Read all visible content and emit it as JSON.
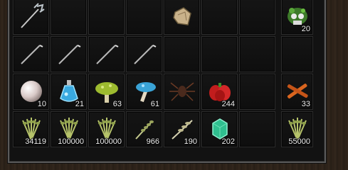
{
  "inventory": {
    "rows": [
      [
        {
          "icon": "trident-icon",
          "qty": ""
        },
        {
          "icon": "",
          "qty": ""
        },
        {
          "icon": "",
          "qty": ""
        },
        {
          "icon": "",
          "qty": ""
        },
        {
          "icon": "rock-chunk-icon",
          "qty": ""
        },
        {
          "icon": "",
          "qty": ""
        },
        {
          "icon": "",
          "qty": ""
        },
        {
          "icon": "skull-moss-icon",
          "qty": "20"
        }
      ],
      [
        {
          "icon": "fishing-hook-icon",
          "qty": ""
        },
        {
          "icon": "fishing-hook-icon",
          "qty": ""
        },
        {
          "icon": "fishing-hook-icon",
          "qty": ""
        },
        {
          "icon": "fishing-hook-icon",
          "qty": ""
        },
        {
          "icon": "",
          "qty": ""
        },
        {
          "icon": "",
          "qty": ""
        },
        {
          "icon": "",
          "qty": ""
        },
        {
          "icon": "",
          "qty": ""
        }
      ],
      [
        {
          "icon": "pearl-icon",
          "qty": "10"
        },
        {
          "icon": "blue-potion-icon",
          "qty": "21"
        },
        {
          "icon": "green-mushroom-icon",
          "qty": "63"
        },
        {
          "icon": "blue-mushroom-icon",
          "qty": "61"
        },
        {
          "icon": "spider-icon",
          "qty": ""
        },
        {
          "icon": "red-peppers-icon",
          "qty": "244"
        },
        {
          "icon": "",
          "qty": ""
        },
        {
          "icon": "cinnamon-sticks-icon",
          "qty": "33"
        }
      ],
      [
        {
          "icon": "herb-bundle-icon",
          "qty": "34119"
        },
        {
          "icon": "herb-bundle-icon",
          "qty": "100000"
        },
        {
          "icon": "herb-bundle-icon",
          "qty": "100000"
        },
        {
          "icon": "wheat-sprig-icon",
          "qty": "966"
        },
        {
          "icon": "wheat-stalk-icon",
          "qty": "190"
        },
        {
          "icon": "emerald-gem-icon",
          "qty": "202"
        },
        {
          "icon": "",
          "qty": ""
        },
        {
          "icon": "herb-bundle-icon",
          "qty": "55000"
        }
      ]
    ]
  }
}
